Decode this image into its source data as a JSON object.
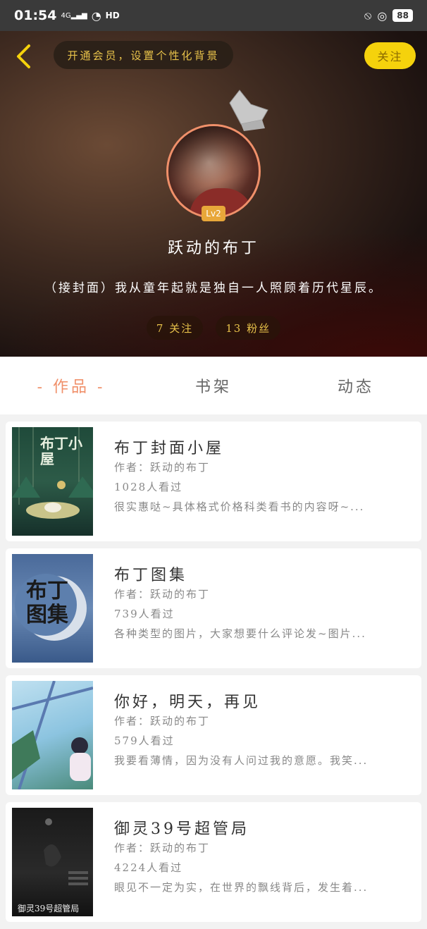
{
  "status": {
    "time": "01:54",
    "network": "4G",
    "hd": "HD",
    "battery": "88"
  },
  "header": {
    "vip_banner": "开通会员，设置个性化背景",
    "follow_label": "关注",
    "level": "Lv2",
    "username": "跃动的布丁",
    "bio": "（接封面）我从童年起就是独自一人照顾着历代星辰。",
    "following": "7 关注",
    "fans": "13 粉丝"
  },
  "tabs": [
    {
      "label": "- 作品 -",
      "active": true
    },
    {
      "label": "书架",
      "active": false
    },
    {
      "label": "动态",
      "active": false
    }
  ],
  "works": [
    {
      "title": "布丁封面小屋",
      "author": "作者：跃动的布丁",
      "views": "1028人看过",
      "desc": "很实惠哒~具体格式价格科类看书的内容呀~...",
      "cover_text": "布丁小屋"
    },
    {
      "title": "布丁图集",
      "author": "作者：跃动的布丁",
      "views": "739人看过",
      "desc": "各种类型的图片，大家想要什么评论发~图片...",
      "cover_text": "布丁图集"
    },
    {
      "title": "你好，明天，再见",
      "author": "作者：跃动的布丁",
      "views": "579人看过",
      "desc": "我要看薄情，因为没有人问过我的意愿。我笑...",
      "cover_text": ""
    },
    {
      "title": "御灵39号超管局",
      "author": "作者：跃动的布丁",
      "views": "4224人看过",
      "desc": "眼见不一定为实，在世界的飘线背后，发生着...",
      "cover_text": "御灵39号超管局"
    }
  ],
  "colors": {
    "accent": "#f0906a",
    "follow_button": "#f5d20c",
    "vip_text": "#e8c24a"
  }
}
